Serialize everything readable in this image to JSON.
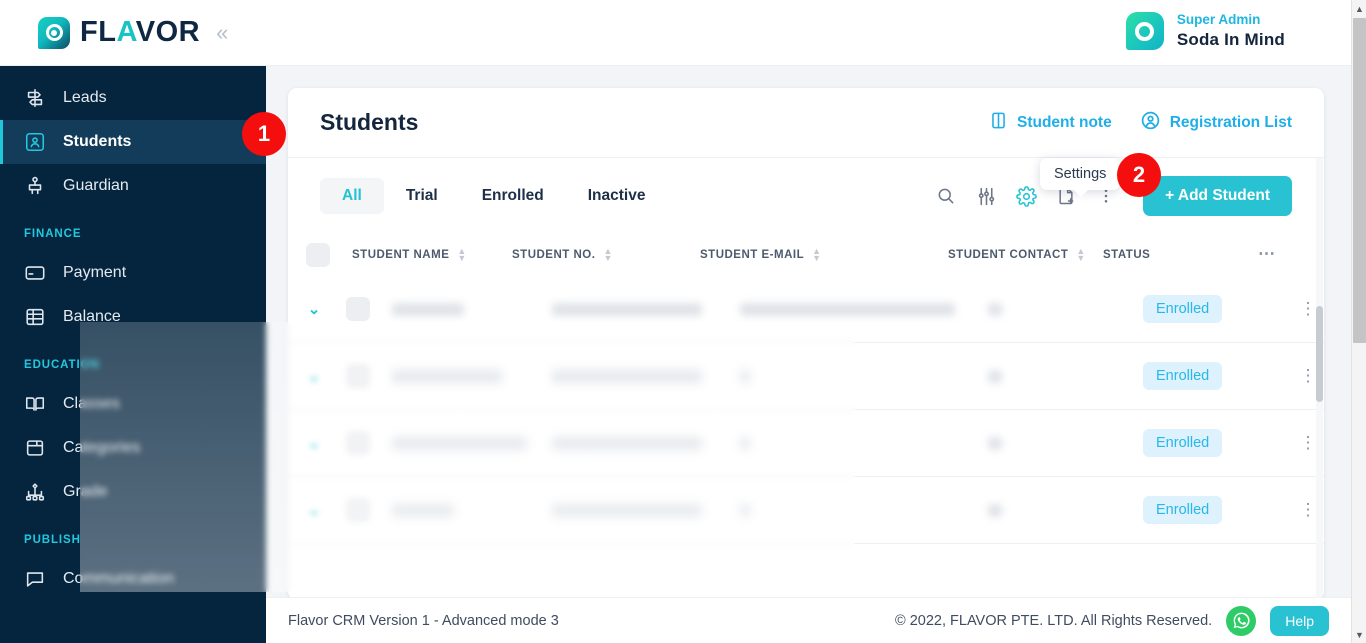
{
  "brand": {
    "logo_text_1": "FL",
    "logo_text_accent": "A",
    "logo_text_2": "VOR",
    "logo_icon": "flavor-ring-logo",
    "collapse_icon": "«"
  },
  "user": {
    "role": "Super Admin",
    "name": "Soda In Mind",
    "avatar_icon": "user-avatar-ring"
  },
  "sidebar": {
    "items": [
      {
        "label": "Leads",
        "icon": "signpost-icon",
        "active": false
      },
      {
        "label": "Students",
        "icon": "student-card-icon",
        "active": true
      },
      {
        "label": "Guardian",
        "icon": "guardian-icon",
        "active": false
      }
    ],
    "sections": [
      {
        "title": "FINANCE",
        "items": [
          {
            "label": "Payment",
            "icon": "credit-card-icon"
          },
          {
            "label": "Balance",
            "icon": "balance-sheet-icon"
          }
        ]
      },
      {
        "title": "EDUCATION",
        "items": [
          {
            "label": "Classes",
            "icon": "open-book-icon"
          },
          {
            "label": "Categories",
            "icon": "box-category-icon"
          },
          {
            "label": "Grade",
            "icon": "hierarchy-grade-icon"
          }
        ]
      },
      {
        "title": "PUBLISH",
        "items": [
          {
            "label": "Communication",
            "icon": "chat-bubble-icon"
          }
        ]
      }
    ]
  },
  "page": {
    "title": "Students",
    "head_links": [
      {
        "label": "Student note",
        "icon": "book-note-icon"
      },
      {
        "label": "Registration List",
        "icon": "user-circle-icon"
      }
    ]
  },
  "tabs": [
    {
      "label": "All",
      "active": true
    },
    {
      "label": "Trial",
      "active": false
    },
    {
      "label": "Enrolled",
      "active": false
    },
    {
      "label": "Inactive",
      "active": false
    }
  ],
  "toolbar": {
    "icons": [
      {
        "name": "search-icon",
        "highlight": false
      },
      {
        "name": "filter-sliders-icon",
        "highlight": false
      },
      {
        "name": "gear-settings-icon",
        "highlight": true
      },
      {
        "name": "document-add-icon",
        "highlight": false
      },
      {
        "name": "more-vertical-icon",
        "highlight": false
      }
    ],
    "add_student_label": "+ Add Student"
  },
  "tooltip": {
    "label": "Settings"
  },
  "step_badges": [
    {
      "number": "1",
      "target": "sidebar-item-students"
    },
    {
      "number": "2",
      "target": "gear-settings-icon"
    }
  ],
  "table": {
    "columns": [
      {
        "label": "STUDENT NAME",
        "sortable": true
      },
      {
        "label": "STUDENT NO.",
        "sortable": true
      },
      {
        "label": "STUDENT E-MAIL",
        "sortable": true
      },
      {
        "label": "STUDENT CONTACT",
        "sortable": true
      },
      {
        "label": "STATUS",
        "sortable": false
      }
    ],
    "rows": [
      {
        "name": "",
        "number": "",
        "email": "",
        "contact": "",
        "status": "Enrolled"
      },
      {
        "name": "",
        "number": "",
        "email": "",
        "contact": "",
        "status": "Enrolled"
      },
      {
        "name": "",
        "number": "",
        "email": "",
        "contact": "",
        "status": "Enrolled"
      },
      {
        "name": "",
        "number": "",
        "email": "",
        "contact": "",
        "status": "Enrolled"
      }
    ]
  },
  "footer": {
    "left": "Flavor CRM Version 1 - Advanced mode 3",
    "copyright": "© 2022, FLAVOR PTE. LTD. All Rights Reserved.",
    "whatsapp_icon": "whatsapp-icon",
    "help_label": "Help"
  },
  "colors": {
    "accent_teal": "#29C2D2",
    "sidebar_bg": "#05253F",
    "link_blue": "#1FAFE8",
    "badge_red": "#F40E0E",
    "status_badge_bg": "#DDF2FC",
    "status_badge_text": "#28B6EC",
    "whatsapp_green": "#2ECC67"
  }
}
